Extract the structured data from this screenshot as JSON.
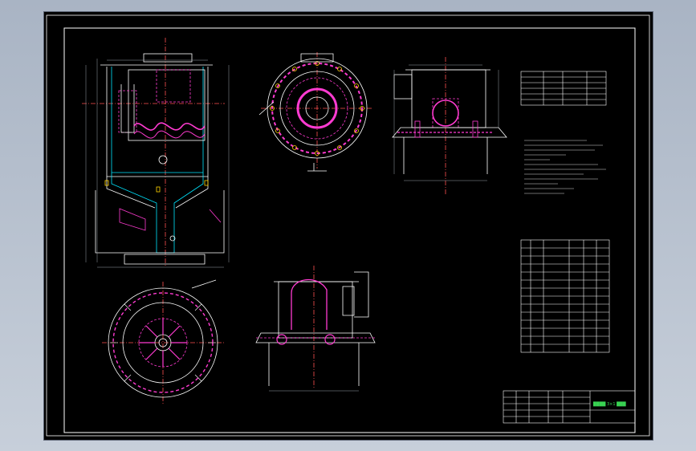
{
  "drawing": {
    "background": "#000000",
    "colors": {
      "outline": "#ffffff",
      "hidden": "#ff3bd1",
      "center": "#ff5050",
      "section": "#00e5ff",
      "dimension": "#9aa0a6",
      "title_text": "#39d353",
      "marker": "#ffd400",
      "view_label": "#39ff14"
    },
    "title_block": {
      "drawing_title": "████ 3×1 ███",
      "rows": 5,
      "cols": 6
    },
    "parts_list": {
      "rows": 14,
      "cols": 6
    },
    "spec_table": {
      "rows": 6,
      "cols": 4
    },
    "views": [
      "front-section-view",
      "top-view",
      "side-view-a",
      "bottom-view",
      "section-view-b"
    ]
  }
}
